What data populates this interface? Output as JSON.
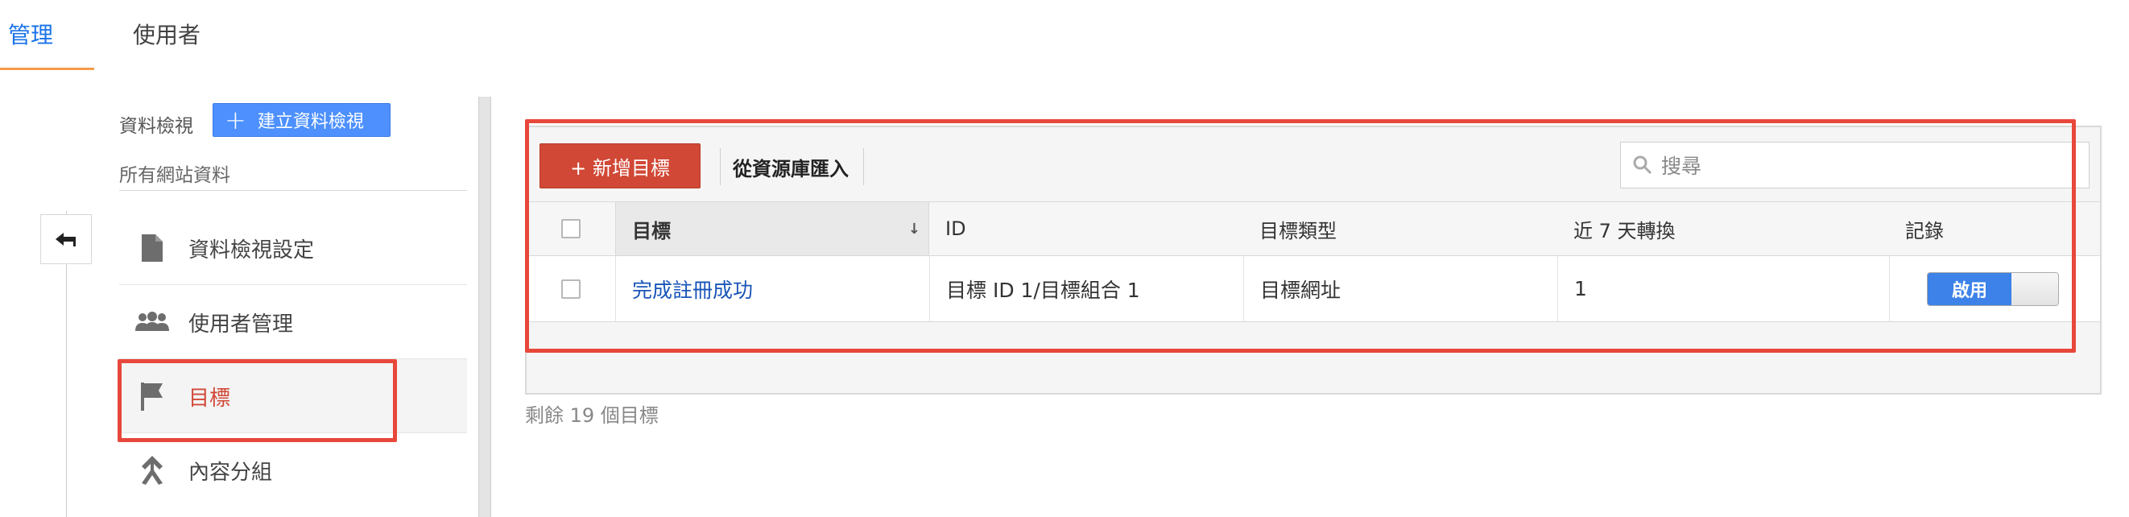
{
  "tabs": [
    {
      "label": "管理"
    },
    {
      "label": "使用者"
    }
  ],
  "nav": {
    "view_label": "資料檢視",
    "create_view_label": "建立資料檢視",
    "all_sites_label": "所有網站資料",
    "items": [
      {
        "label": "資料檢視設定",
        "icon": "document-icon"
      },
      {
        "label": "使用者管理",
        "icon": "users-icon"
      },
      {
        "label": "目標",
        "icon": "flag-icon",
        "selected": true
      },
      {
        "label": "內容分組",
        "icon": "content-grouping-icon"
      }
    ]
  },
  "toolbar": {
    "add_goal_label": "+ 新增目標",
    "import_label": "從資源庫匯入",
    "search_placeholder": "搜尋"
  },
  "table": {
    "columns": [
      "目標",
      "ID",
      "目標類型",
      "近 7 天轉換",
      "記錄"
    ],
    "rows": [
      {
        "goal": "完成註冊成功",
        "id": "目標 ID 1/目標組合 1",
        "type": "目標網址",
        "conversions": "1",
        "recording": "啟用"
      }
    ]
  },
  "remaining_text": "剩餘 19 個目標",
  "colors": {
    "accent_blue": "#1a73e8",
    "add_button_red": "#d14836",
    "highlight_red": "#e8473b",
    "toggle_blue": "#3c82e8"
  }
}
